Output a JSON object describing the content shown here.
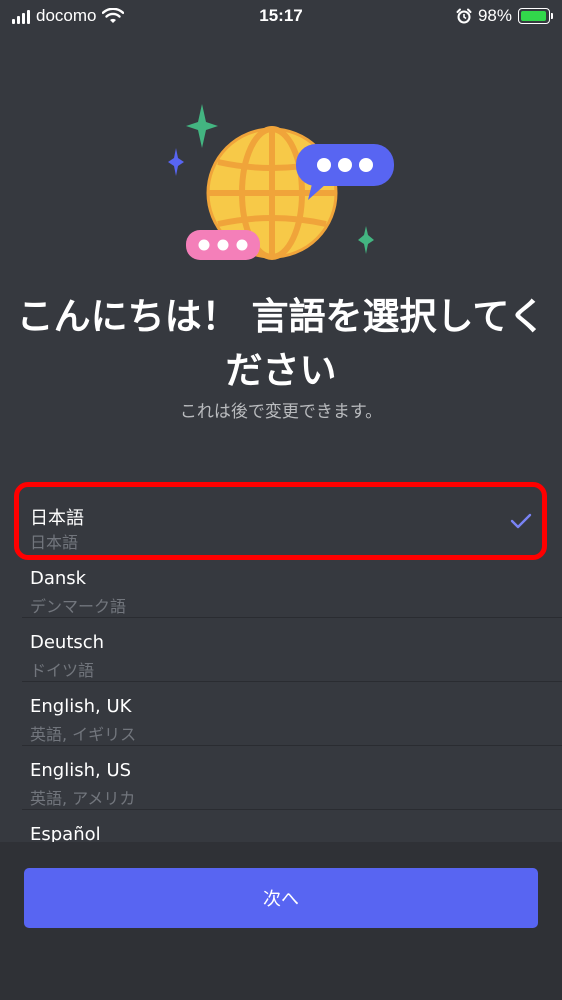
{
  "status_bar": {
    "carrier": "docomo",
    "time": "15:17",
    "battery": "98%",
    "battery_level": 0.98
  },
  "hero": {
    "icon": "globe-speech-bubbles-illustration",
    "colors": {
      "globe": "#f7c948",
      "bubble_blue": "#5865f2",
      "bubble_pink": "#f47fb9",
      "sparkle_green": "#43b581"
    }
  },
  "headline": {
    "line1": "こんにちは！ 言語を選択してく",
    "line2": "ださい"
  },
  "subtitle": "これは後で変更できます。",
  "languages": [
    {
      "name": "日本語",
      "native": "日本語",
      "selected": true
    },
    {
      "name": "Dansk",
      "native": "デンマーク語",
      "selected": false
    },
    {
      "name": "Deutsch",
      "native": "ドイツ語",
      "selected": false
    },
    {
      "name": "English, UK",
      "native": "英語, イギリス",
      "selected": false
    },
    {
      "name": "English, US",
      "native": "英語, アメリカ",
      "selected": false
    },
    {
      "name": "Español",
      "native": "",
      "selected": false
    }
  ],
  "next_button_label": "次へ",
  "colors": {
    "background": "#36393f",
    "accent": "#5865f2",
    "highlight": "#ff0000"
  }
}
